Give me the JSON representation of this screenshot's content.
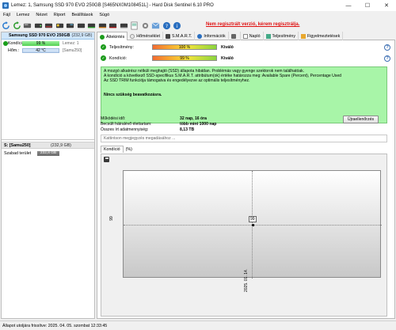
{
  "window": {
    "title": "Lemez: 1, Samsung SSD 970 EVO 250GB [S465NX0M108451L]  -  Hard Disk Sentinel 6.10 PRO",
    "minimize": "—",
    "maximize": "☐",
    "close": "✕"
  },
  "menu": [
    "Fájl",
    "Lemez",
    "Nézet",
    "Riport",
    "Beállítások",
    "Súgó"
  ],
  "toolbar": {
    "unregistered": "Nem regisztrált verzió, kérem regisztrálja."
  },
  "left": {
    "disk_name": "Samsung SSD 970 EVO 250GB",
    "disk_size": "(232,9 GB)",
    "condition_label": "Kondíció:",
    "condition_value": "99 %",
    "condition_extra": "Lemez: 1",
    "temp_label": "Hőm.:",
    "temp_value": "42 °C",
    "temp_extra": "[Samu250]",
    "volume_name": "S: [Samu250]",
    "volume_size": "(232,9 GB)",
    "free_label": "Szabad terület",
    "free_value": "232,8 GB"
  },
  "tabs": [
    "Áttekintés",
    "Hőmérséklet",
    "S.M.A.R.T.",
    "Információk",
    "",
    "Napló",
    "Teljesítmény",
    "Figyelmeztetések"
  ],
  "overview": {
    "performance_label": "Teljesítmény:",
    "performance_value": "100 %",
    "performance_percent": 100,
    "performance_rating": "Kiváló",
    "condition_label": "Kondíció:",
    "condition_value": "99 %",
    "condition_percent": 99,
    "condition_rating": "Kiváló",
    "message_lines": [
      "A mozgó alkatrész nélküli meghajtó (SSD) állapota hibátlan. Problémás vagy gyenge szektorok nem találhatóak.",
      "A kondíció a következő SSD-specifikus S.M.A.R.T. attribútum(ok) értéke határozza meg:  Available Spare (Percent), Percentage Used",
      "Az SSD TRIM funkciója támogatva és engedélyezve az optimális teljesítményhez."
    ],
    "message_hint": "Nincs szükség beavatkozásra.",
    "uptime_label": "Működési idő:",
    "uptime_value": "32 nap, 16 óra",
    "remaining_label": "Becsült hátralévő élettartam:",
    "remaining_value": "több mint 1000 nap",
    "written_label": "Összes írt adatmennyiség:",
    "written_value": "8,13 TB",
    "refresh_button": "Újraellenőrzés",
    "comment_placeholder": "Kattintson megjegyzés megadásához ..."
  },
  "chart_tabs": [
    "Kondíció",
    "(%)"
  ],
  "chart_data": {
    "type": "line",
    "title": "",
    "xlabel": "",
    "ylabel": "",
    "x": [
      "2025. 01. 14."
    ],
    "series": [
      {
        "values": [
          99
        ]
      }
    ],
    "y_tick": "99",
    "point_label": "99",
    "grid": true
  },
  "status": "Állapot utoljára frissítve: 2025. 04. 05. szombat 12:33:45"
}
